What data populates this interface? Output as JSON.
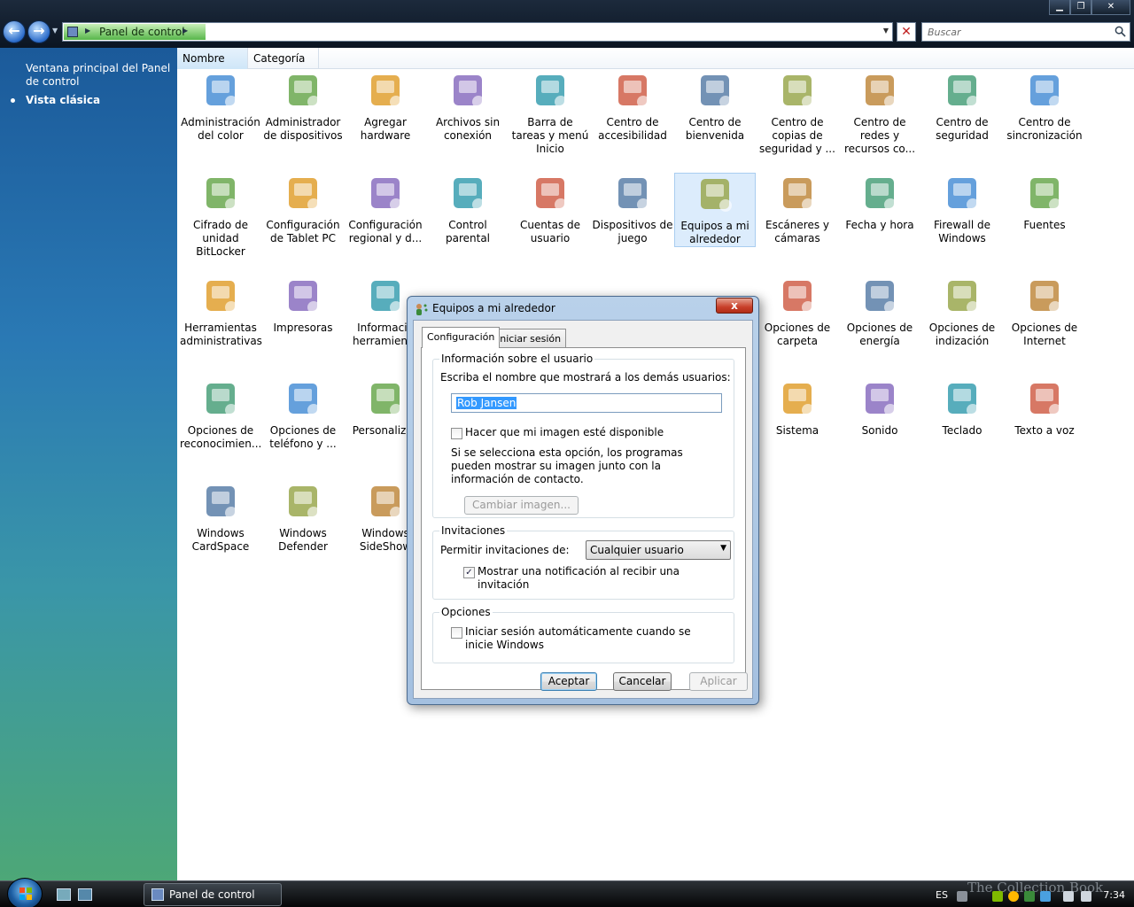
{
  "window": {
    "title_path": "Panel de control",
    "search_placeholder": "Buscar"
  },
  "leftpane": {
    "home_link": "Ventana principal del Panel de control",
    "classic_view": "Vista clásica"
  },
  "columns": {
    "name": "Nombre",
    "category": "Categoría"
  },
  "items": [
    {
      "label": "Administración del color",
      "icon": "color-management-icon"
    },
    {
      "label": "Administrador de dispositivos",
      "icon": "device-manager-icon"
    },
    {
      "label": "Agregar hardware",
      "icon": "add-hardware-icon"
    },
    {
      "label": "Archivos sin conexión",
      "icon": "offline-files-icon"
    },
    {
      "label": "Barra de tareas y menú Inicio",
      "icon": "taskbar-start-menu-icon"
    },
    {
      "label": "Centro de accesibilidad",
      "icon": "accessibility-center-icon"
    },
    {
      "label": "Centro de bienvenida",
      "icon": "welcome-center-icon"
    },
    {
      "label": "Centro de copias de seguridad y ...",
      "icon": "backup-center-icon"
    },
    {
      "label": "Centro de redes y recursos co...",
      "icon": "network-center-icon"
    },
    {
      "label": "Centro de seguridad",
      "icon": "security-center-icon"
    },
    {
      "label": "Centro de sincronización",
      "icon": "sync-center-icon"
    },
    {
      "label": "Cifrado de unidad BitLocker",
      "icon": "bitlocker-icon"
    },
    {
      "label": "Configuración de Tablet PC",
      "icon": "tablet-pc-icon"
    },
    {
      "label": "Configuración regional y d...",
      "icon": "regional-settings-icon"
    },
    {
      "label": "Control parental",
      "icon": "parental-control-icon"
    },
    {
      "label": "Cuentas de usuario",
      "icon": "user-accounts-icon"
    },
    {
      "label": "Dispositivos de juego",
      "icon": "game-controllers-icon"
    },
    {
      "label": "Equipos a mi alrededor",
      "icon": "people-near-me-icon"
    },
    {
      "label": "Escáneres y cámaras",
      "icon": "scanners-cameras-icon"
    },
    {
      "label": "Fecha y hora",
      "icon": "date-time-icon"
    },
    {
      "label": "Firewall de Windows",
      "icon": "firewall-icon"
    },
    {
      "label": "Fuentes",
      "icon": "fonts-icon"
    },
    {
      "label": "Herramientas administrativas",
      "icon": "admin-tools-icon"
    },
    {
      "label": "Impresoras",
      "icon": "printers-icon"
    },
    {
      "label": "Informació herramienta",
      "icon": "performance-info-icon"
    },
    {
      "label": "Opciones de carpeta",
      "icon": "folder-options-icon"
    },
    {
      "label": "Opciones de energía",
      "icon": "power-options-icon"
    },
    {
      "label": "Opciones de indización",
      "icon": "indexing-options-icon"
    },
    {
      "label": "Opciones de Internet",
      "icon": "internet-options-icon"
    },
    {
      "label": "Opciones de reconocimien...",
      "icon": "speech-recognition-icon"
    },
    {
      "label": "Opciones de teléfono y ...",
      "icon": "phone-modem-icon"
    },
    {
      "label": "Personalizac",
      "icon": "personalization-icon"
    },
    {
      "label": "Sistema",
      "icon": "system-icon"
    },
    {
      "label": "Sonido",
      "icon": "sound-icon"
    },
    {
      "label": "Teclado",
      "icon": "keyboard-icon"
    },
    {
      "label": "Texto a voz",
      "icon": "text-to-speech-icon"
    },
    {
      "label": "Windows CardSpace",
      "icon": "cardspace-icon"
    },
    {
      "label": "Windows Defender",
      "icon": "defender-icon"
    },
    {
      "label": "Windows SideShow",
      "icon": "sideshow-icon"
    }
  ],
  "dialog": {
    "title": "Equipos a mi alrededor",
    "close": "x",
    "tabs": [
      "Configuración",
      "Iniciar sesión"
    ],
    "user_group": {
      "label": "Información sobre el usuario",
      "prompt": "Escriba el nombre que mostrará a los demás usuarios:",
      "name_value": "Rob Jansen",
      "picture_checkbox": "Hacer que mi imagen esté disponible",
      "picture_checked": false,
      "picture_note": "Si se selecciona esta opción, los programas pueden mostrar su imagen junto con la información de contacto.",
      "change_picture_button": "Cambiar imagen..."
    },
    "invite_group": {
      "label": "Invitaciones",
      "allow_label": "Permitir invitaciones de:",
      "allow_value": "Cualquier usuario",
      "notify_checkbox": "Mostrar una notificación al recibir una invitación",
      "notify_checked": true
    },
    "options_group": {
      "label": "Opciones",
      "autosignin_checkbox": "Iniciar sesión automáticamente cuando se inicie Windows",
      "autosignin_checked": false
    },
    "buttons": {
      "ok": "Aceptar",
      "cancel": "Cancelar",
      "apply": "Aplicar"
    }
  },
  "taskbar": {
    "task_label": "Panel de control",
    "lang": "ES",
    "watermark": "The Collection Book",
    "time": "7:34"
  },
  "colors": {
    "accent": "#3399ff",
    "selection": "#dcecfc",
    "path_green": "#57b64a"
  }
}
